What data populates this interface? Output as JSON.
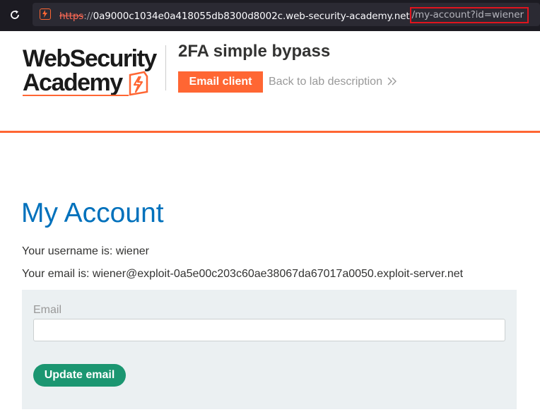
{
  "browser": {
    "url_scheme": "https",
    "url_separator": "://",
    "url_host": "0a9000c1034e0a418055db8300d8002c.web-security-academy.net",
    "url_path": "/my-account?id=wiener"
  },
  "header": {
    "logo_line1": "WebSecurity",
    "logo_line2": "Academy",
    "lab_title": "2FA simple bypass",
    "email_client_label": "Email client",
    "back_link_label": "Back to lab description"
  },
  "main": {
    "title": "My Account",
    "username_line": "Your username is: wiener",
    "email_line": "Your email is: wiener@exploit-0a5e00c203c60ae38067da67017a0050.exploit-server.net",
    "form": {
      "email_label": "Email",
      "email_value": "",
      "update_button_label": "Update email"
    }
  },
  "colors": {
    "accent_orange": "#ff6633",
    "title_blue": "#0071bc",
    "button_green": "#1b9671",
    "form_background": "#ebf0f2",
    "highlight_red": "#e0141e"
  },
  "icons": {
    "reload": "reload-icon",
    "site": "lightning-site-icon",
    "back": "double-chevron-right-icon"
  }
}
